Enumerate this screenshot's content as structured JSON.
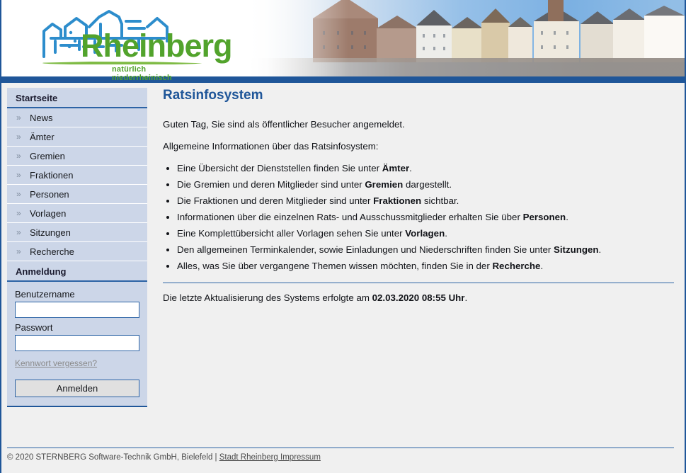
{
  "header": {
    "logo": {
      "name": "Rheinberg",
      "tagline": "natürlich niederrheinisch",
      "text_color": "#52a32c",
      "sketch_color": "#2d8dcc"
    },
    "band_color": "#1f5699"
  },
  "sidebar": {
    "nav_header": "Startseite",
    "items": [
      {
        "label": "News",
        "chevron": "»"
      },
      {
        "label": "Ämter",
        "chevron": "»"
      },
      {
        "label": "Gremien",
        "chevron": "»"
      },
      {
        "label": "Fraktionen",
        "chevron": "»"
      },
      {
        "label": "Personen",
        "chevron": "»"
      },
      {
        "label": "Vorlagen",
        "chevron": "»"
      },
      {
        "label": "Sitzungen",
        "chevron": "»"
      },
      {
        "label": "Recherche",
        "chevron": "»"
      }
    ],
    "login": {
      "header": "Anmeldung",
      "username_label": "Benutzername",
      "username_value": "",
      "password_label": "Passwort",
      "password_value": "",
      "forgot_link": "Kennwort vergessen?",
      "submit_label": "Anmelden"
    }
  },
  "main": {
    "title": "Ratsinfosystem",
    "greeting": "Guten Tag, Sie sind als öffentlicher Besucher angemeldet.",
    "intro": "Allgemeine Informationen über das Ratsinfosystem:",
    "bullets": [
      {
        "before": "Eine Übersicht der Dienststellen finden Sie unter ",
        "strong": "Ämter",
        "after": "."
      },
      {
        "before": "Die Gremien und deren Mitglieder sind unter ",
        "strong": "Gremien",
        "after": " dargestellt."
      },
      {
        "before": "Die Fraktionen und deren Mitglieder sind unter ",
        "strong": "Fraktionen",
        "after": " sichtbar."
      },
      {
        "before": "Informationen über die einzelnen Rats- und Ausschussmitglieder erhalten Sie über ",
        "strong": "Personen",
        "after": "."
      },
      {
        "before": "Eine Komplettübersicht aller Vorlagen sehen Sie unter ",
        "strong": "Vorlagen",
        "after": "."
      },
      {
        "before": "Den allgemeinen Terminkalender, sowie Einladungen und Niederschriften finden Sie unter ",
        "strong": "Sitzungen",
        "after": "."
      },
      {
        "before": "Alles, was Sie über vergangene Themen wissen möchten, finden Sie in der ",
        "strong": "Recherche",
        "after": "."
      }
    ],
    "updated": {
      "before": "Die letzte Aktualisierung des Systems erfolgte am ",
      "strong": "02.03.2020 08:55 Uhr",
      "after": "."
    }
  },
  "footer": {
    "copyright": "© 2020 STERNBERG Software-Technik GmbH, Bielefeld | ",
    "link": "Stadt Rheinberg Impressum"
  }
}
